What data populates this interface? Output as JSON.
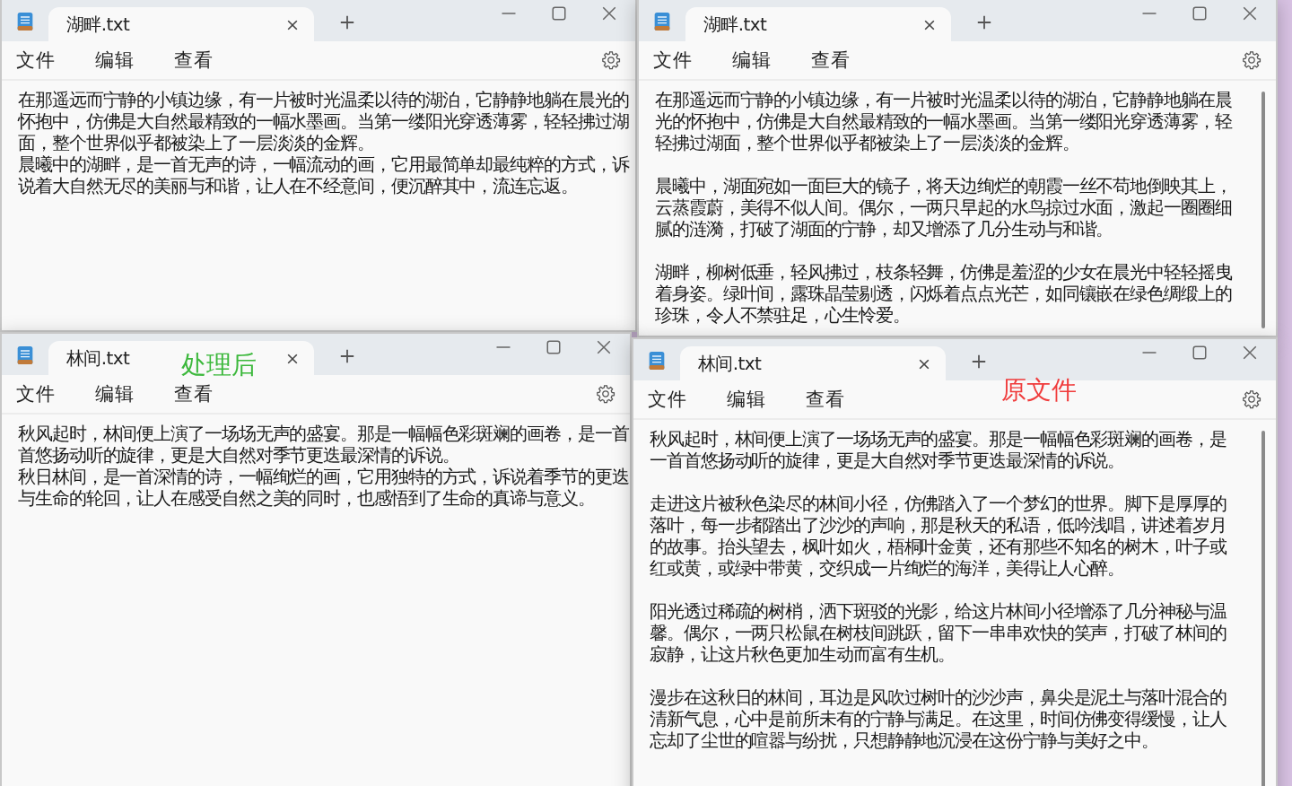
{
  "windows": [
    {
      "kind": "compact",
      "tab_title": "湖畔.txt",
      "menu": [
        "文件",
        "编辑",
        "查看"
      ],
      "paragraphs": [
        "在那遥远而宁静的小镇边缘，有一片被时光温柔以待的湖泊，它静静地躺在晨光的怀抱中，仿佛是大自然最精致的一幅水墨画。当第一缕阳光穿透薄雾，轻轻拂过湖面，整个世界似乎都被染上了一层淡淡的金辉。",
        "晨曦中的湖畔，是一首无声的诗，一幅流动的画，它用最简单却最纯粹的方式，诉说着大自然无尽的美丽与和谐，让人在不经意间，便沉醉其中，流连忘返。"
      ]
    },
    {
      "kind": "spaced",
      "tab_title": "湖畔.txt",
      "menu": [
        "文件",
        "编辑",
        "查看"
      ],
      "paragraphs": [
        "在那遥远而宁静的小镇边缘，有一片被时光温柔以待的湖泊，它静静地躺在晨光的怀抱中，仿佛是大自然最精致的一幅水墨画。当第一缕阳光穿透薄雾，轻轻拂过湖面，整个世界似乎都被染上了一层淡淡的金辉。",
        "晨曦中，湖面宛如一面巨大的镜子，将天边绚烂的朝霞一丝不苟地倒映其上，云蒸霞蔚，美得不似人间。偶尔，一两只早起的水鸟掠过水面，激起一圈圈细腻的涟漪，打破了湖面的宁静，却又增添了几分生动与和谐。",
        "湖畔，柳树低垂，轻风拂过，枝条轻舞，仿佛是羞涩的少女在晨光中轻轻摇曳着身姿。绿叶间，露珠晶莹剔透，闪烁着点点光芒，如同镶嵌在绿色绸缎上的珍珠，令人不禁驻足，心生怜爱。"
      ]
    },
    {
      "kind": "compact",
      "tab_title": "林间.txt",
      "menu": [
        "文件",
        "编辑",
        "查看"
      ],
      "annotation": {
        "text": "处理后",
        "color": "#3cb83c"
      },
      "paragraphs": [
        "秋风起时，林间便上演了一场场无声的盛宴。那是一幅幅色彩斑斓的画卷，是一首首悠扬动听的旋律，更是大自然对季节更迭最深情的诉说。",
        "秋日林间，是一首深情的诗，一幅绚烂的画，它用独特的方式，诉说着季节的更迭与生命的轮回，让人在感受自然之美的同时，也感悟到了生命的真谛与意义。"
      ]
    },
    {
      "kind": "spaced",
      "tab_title": "林间.txt",
      "menu": [
        "文件",
        "编辑",
        "查看"
      ],
      "annotation": {
        "text": "原文件",
        "color": "#f03c3c"
      },
      "paragraphs": [
        "秋风起时，林间便上演了一场场无声的盛宴。那是一幅幅色彩斑斓的画卷，是一首首悠扬动听的旋律，更是大自然对季节更迭最深情的诉说。",
        "走进这片被秋色染尽的林间小径，仿佛踏入了一个梦幻的世界。脚下是厚厚的落叶，每一步都踏出了沙沙的声响，那是秋天的私语，低吟浅唱，讲述着岁月的故事。抬头望去，枫叶如火，梧桐叶金黄，还有那些不知名的树木，叶子或红或黄，或绿中带黄，交织成一片绚烂的海洋，美得让人心醉。",
        "阳光透过稀疏的树梢，洒下斑驳的光影，给这片林间小径增添了几分神秘与温馨。偶尔，一两只松鼠在树枝间跳跃，留下一串串欢快的笑声，打破了林间的寂静，让这片秋色更加生动而富有生机。",
        "漫步在这秋日的林间，耳边是风吹过树叶的沙沙声，鼻尖是泥土与落叶混合的清新气息，心中是前所未有的宁静与满足。在这里，时间仿佛变得缓慢，让人忘却了尘世的喧嚣与纷扰，只想静静地沉浸在这份宁静与美好之中。"
      ]
    }
  ]
}
